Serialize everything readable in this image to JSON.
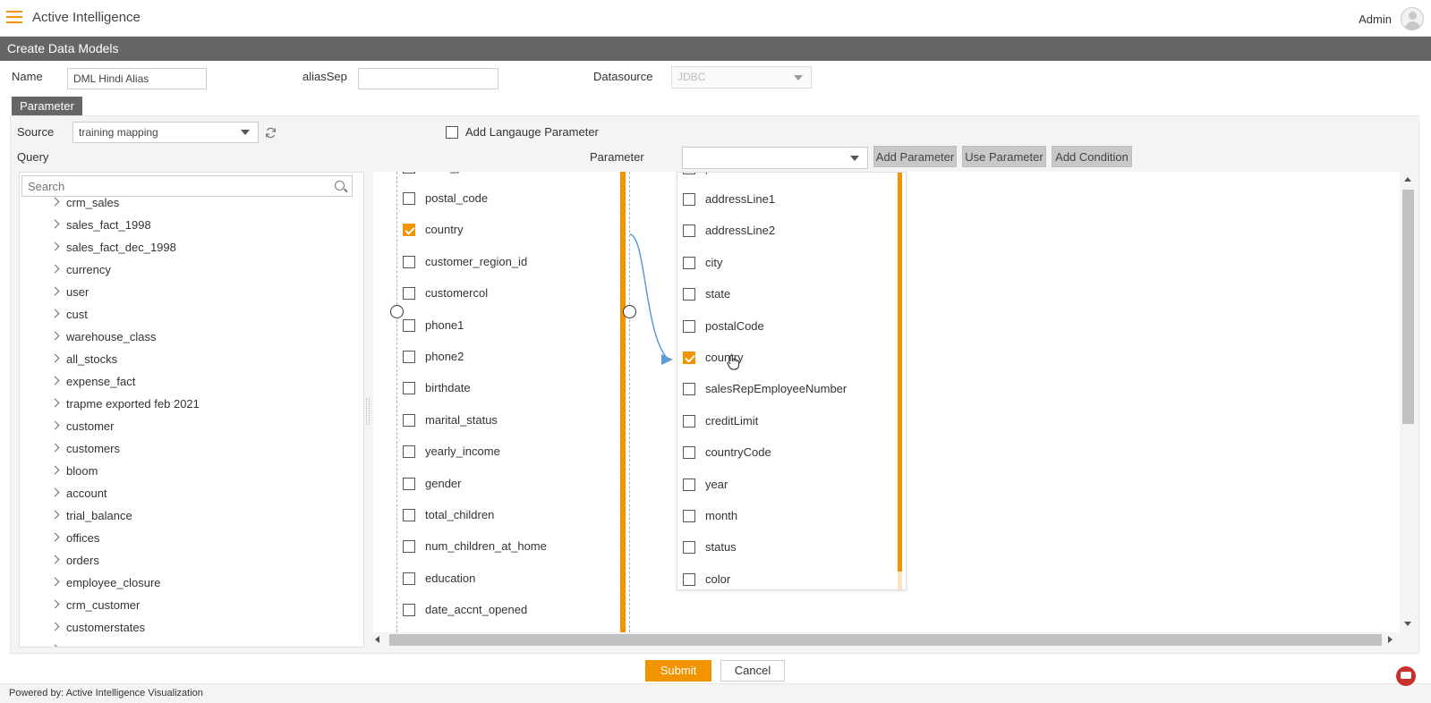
{
  "header": {
    "app_title": "Active Intelligence",
    "user_name": "Admin"
  },
  "page": {
    "title": "Create Data Models"
  },
  "form": {
    "name_label": "Name",
    "name_value": "DML Hindi Alias",
    "aliassep_label": "aliasSep",
    "aliassep_value": "",
    "datasource_label": "Datasource",
    "datasource_value": "JDBC"
  },
  "tabs": {
    "parameter": "Parameter"
  },
  "source": {
    "label": "Source",
    "value": "training mapping"
  },
  "add_language_param": {
    "label": "Add Langauge Parameter",
    "checked": false
  },
  "query": {
    "label": "Query"
  },
  "parameter": {
    "label": "Parameter",
    "value": "",
    "buttons": {
      "add_parameter": "Add Parameter",
      "use_parameter": "Use Parameter",
      "add_condition": "Add Condition"
    }
  },
  "search": {
    "placeholder": "Search"
  },
  "tree_items": [
    "crm_sales",
    "sales_fact_1998",
    "sales_fact_dec_1998",
    "currency",
    "user",
    "cust",
    "warehouse_class",
    "all_stocks",
    "expense_fact",
    "trapme exported feb 2021",
    "customer",
    "customers",
    "bloom",
    "account",
    "trial_balance",
    "offices",
    "orders",
    "employee_closure",
    "crm_customer",
    "customerstates"
  ],
  "left_table": {
    "partial_top": "state_province",
    "columns": [
      {
        "name": "postal_code",
        "checked": false
      },
      {
        "name": "country",
        "checked": true
      },
      {
        "name": "customer_region_id",
        "checked": false
      },
      {
        "name": "customercol",
        "checked": false
      },
      {
        "name": "phone1",
        "checked": false
      },
      {
        "name": "phone2",
        "checked": false
      },
      {
        "name": "birthdate",
        "checked": false
      },
      {
        "name": "marital_status",
        "checked": false
      },
      {
        "name": "yearly_income",
        "checked": false
      },
      {
        "name": "gender",
        "checked": false
      },
      {
        "name": "total_children",
        "checked": false
      },
      {
        "name": "num_children_at_home",
        "checked": false
      },
      {
        "name": "education",
        "checked": false
      },
      {
        "name": "date_accnt_opened",
        "checked": false
      }
    ]
  },
  "right_table": {
    "partial_top": "phone",
    "columns": [
      {
        "name": "addressLine1",
        "checked": false
      },
      {
        "name": "addressLine2",
        "checked": false
      },
      {
        "name": "city",
        "checked": false
      },
      {
        "name": "state",
        "checked": false
      },
      {
        "name": "postalCode",
        "checked": false
      },
      {
        "name": "country",
        "checked": true
      },
      {
        "name": "salesRepEmployeeNumber",
        "checked": false
      },
      {
        "name": "creditLimit",
        "checked": false
      },
      {
        "name": "countryCode",
        "checked": false
      },
      {
        "name": "year",
        "checked": false
      },
      {
        "name": "month",
        "checked": false
      },
      {
        "name": "status",
        "checked": false
      },
      {
        "name": "color",
        "checked": false
      }
    ]
  },
  "actions": {
    "submit": "Submit",
    "cancel": "Cancel"
  },
  "footer": {
    "powered_by": "Powered by: Active Intelligence Visualization"
  },
  "colors": {
    "accent": "#f29400",
    "header_bar": "#666666",
    "link_line": "#5b9bd5"
  }
}
